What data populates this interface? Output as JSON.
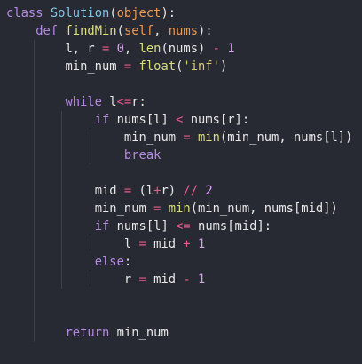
{
  "theme": {
    "background": "#282a33",
    "indent_guide": "#3d3f4a",
    "colors": {
      "kw": "#b48ae0",
      "cls": "#7ec7e6",
      "def": "#dee27f",
      "builtin": "#d9de7a",
      "param": "#e89a56",
      "num": "#d9a0f0",
      "str": "#d7cb73",
      "op": "#ea5a8a",
      "plain": "#e6e6e6"
    }
  },
  "code": {
    "language": "python",
    "lines": [
      {
        "indent": 0,
        "tokens": [
          {
            "t": "class",
            "c": "kw"
          },
          {
            "t": " ",
            "c": "plain"
          },
          {
            "t": "Solution",
            "c": "cls"
          },
          {
            "t": "(",
            "c": "plain"
          },
          {
            "t": "object",
            "c": "param"
          },
          {
            "t": "):",
            "c": "plain"
          }
        ]
      },
      {
        "indent": 1,
        "tokens": [
          {
            "t": "def",
            "c": "kw"
          },
          {
            "t": " ",
            "c": "plain"
          },
          {
            "t": "findMin",
            "c": "def"
          },
          {
            "t": "(",
            "c": "plain"
          },
          {
            "t": "self",
            "c": "param"
          },
          {
            "t": ", ",
            "c": "plain"
          },
          {
            "t": "nums",
            "c": "param"
          },
          {
            "t": "):",
            "c": "plain"
          }
        ]
      },
      {
        "indent": 2,
        "tokens": [
          {
            "t": "l, r ",
            "c": "plain"
          },
          {
            "t": "=",
            "c": "op"
          },
          {
            "t": " ",
            "c": "plain"
          },
          {
            "t": "0",
            "c": "num"
          },
          {
            "t": ", ",
            "c": "plain"
          },
          {
            "t": "len",
            "c": "builtin"
          },
          {
            "t": "(nums) ",
            "c": "plain"
          },
          {
            "t": "-",
            "c": "op"
          },
          {
            "t": " ",
            "c": "plain"
          },
          {
            "t": "1",
            "c": "num"
          }
        ]
      },
      {
        "indent": 2,
        "tokens": [
          {
            "t": "min_num ",
            "c": "plain"
          },
          {
            "t": "=",
            "c": "op"
          },
          {
            "t": " ",
            "c": "plain"
          },
          {
            "t": "float",
            "c": "builtin"
          },
          {
            "t": "(",
            "c": "plain"
          },
          {
            "t": "'inf'",
            "c": "str"
          },
          {
            "t": ")",
            "c": "plain"
          }
        ]
      },
      {
        "indent": 2,
        "tokens": []
      },
      {
        "indent": 2,
        "tokens": [
          {
            "t": "while",
            "c": "kw"
          },
          {
            "t": " l",
            "c": "plain"
          },
          {
            "t": "<=",
            "c": "op"
          },
          {
            "t": "r:",
            "c": "plain"
          }
        ]
      },
      {
        "indent": 3,
        "tokens": [
          {
            "t": "if",
            "c": "kw"
          },
          {
            "t": " nums[l] ",
            "c": "plain"
          },
          {
            "t": "<",
            "c": "op"
          },
          {
            "t": " nums[r]:",
            "c": "plain"
          }
        ]
      },
      {
        "indent": 4,
        "tokens": [
          {
            "t": "min_num ",
            "c": "plain"
          },
          {
            "t": "=",
            "c": "op"
          },
          {
            "t": " ",
            "c": "plain"
          },
          {
            "t": "min",
            "c": "builtin"
          },
          {
            "t": "(min_num, nums[l])",
            "c": "plain"
          }
        ]
      },
      {
        "indent": 4,
        "tokens": [
          {
            "t": "break",
            "c": "kw"
          }
        ]
      },
      {
        "indent": 3,
        "tokens": []
      },
      {
        "indent": 3,
        "tokens": [
          {
            "t": "mid ",
            "c": "plain"
          },
          {
            "t": "=",
            "c": "op"
          },
          {
            "t": " (l",
            "c": "plain"
          },
          {
            "t": "+",
            "c": "op"
          },
          {
            "t": "r) ",
            "c": "plain"
          },
          {
            "t": "//",
            "c": "op"
          },
          {
            "t": " ",
            "c": "plain"
          },
          {
            "t": "2",
            "c": "num"
          }
        ]
      },
      {
        "indent": 3,
        "tokens": [
          {
            "t": "min_num ",
            "c": "plain"
          },
          {
            "t": "=",
            "c": "op"
          },
          {
            "t": " ",
            "c": "plain"
          },
          {
            "t": "min",
            "c": "builtin"
          },
          {
            "t": "(min_num, nums[mid])",
            "c": "plain"
          }
        ]
      },
      {
        "indent": 3,
        "tokens": [
          {
            "t": "if",
            "c": "kw"
          },
          {
            "t": " nums[l] ",
            "c": "plain"
          },
          {
            "t": "<=",
            "c": "op"
          },
          {
            "t": " nums[mid]:",
            "c": "plain"
          }
        ]
      },
      {
        "indent": 4,
        "tokens": [
          {
            "t": "l ",
            "c": "plain"
          },
          {
            "t": "=",
            "c": "op"
          },
          {
            "t": " mid ",
            "c": "plain"
          },
          {
            "t": "+",
            "c": "op"
          },
          {
            "t": " ",
            "c": "plain"
          },
          {
            "t": "1",
            "c": "num"
          }
        ]
      },
      {
        "indent": 3,
        "tokens": [
          {
            "t": "else",
            "c": "kw"
          },
          {
            "t": ":",
            "c": "plain"
          }
        ]
      },
      {
        "indent": 4,
        "tokens": [
          {
            "t": "r ",
            "c": "plain"
          },
          {
            "t": "=",
            "c": "op"
          },
          {
            "t": " mid ",
            "c": "plain"
          },
          {
            "t": "-",
            "c": "op"
          },
          {
            "t": " ",
            "c": "plain"
          },
          {
            "t": "1",
            "c": "num"
          }
        ]
      },
      {
        "indent": 2,
        "tokens": []
      },
      {
        "indent": 2,
        "tokens": []
      },
      {
        "indent": 2,
        "tokens": [
          {
            "t": "return",
            "c": "kw"
          },
          {
            "t": " min_num",
            "c": "plain"
          }
        ]
      }
    ]
  }
}
